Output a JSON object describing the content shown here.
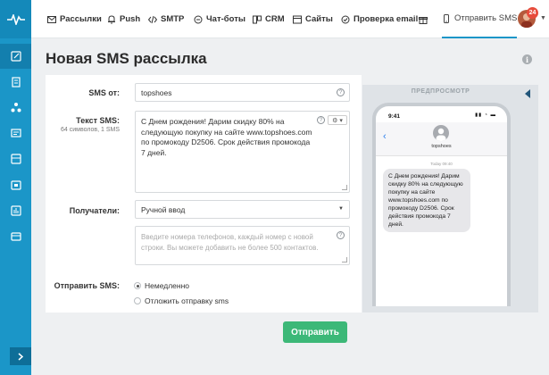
{
  "nav": {
    "items": [
      {
        "label": "Рассылки",
        "icon": "mail-icon"
      },
      {
        "label": "Push",
        "icon": "bell-icon"
      },
      {
        "label": "SMTP",
        "icon": "code-icon"
      },
      {
        "label": "Чат-боты",
        "icon": "chat-icon"
      },
      {
        "label": "CRM",
        "icon": "crm-icon"
      },
      {
        "label": "Сайты",
        "icon": "site-icon"
      },
      {
        "label": "Проверка email",
        "icon": "check-circle-icon"
      },
      {
        "label": "",
        "icon": "gift-icon"
      },
      {
        "label": "Отправить SMS",
        "icon": "phone-icon"
      }
    ],
    "badge_count": "24"
  },
  "page": {
    "title": "Новая SMS рассылка"
  },
  "form": {
    "sender_label": "SMS от:",
    "sender_value": "topshoes",
    "text_label": "Текст SMS:",
    "text_meta": "64 символов, 1 SMS",
    "text_value": "С Днем рождения! Дарим скидку 80% на следующую покупку на сайте www.topshoes.com по промокоду D2506. Срок действия промокода 7 дней.",
    "recipients_label": "Получатели:",
    "recipients_value": "Ручной ввод",
    "phones_placeholder": "Введите номера телефонов, каждый номер с новой строки. Вы можете добавить не более 500 контактов.",
    "send_label": "Отправить SMS:",
    "send_options": [
      "Немедленно",
      "Отложить отправку sms"
    ],
    "send_selected": 0,
    "submit_label": "Отправить"
  },
  "preview": {
    "title": "ПРЕДПРОСМОТР",
    "status_time": "9:41",
    "sender": "topshoes",
    "message_time": "Today 09:40",
    "message": "С Днем рождения! Дарим скидку 80% на следующую покупку на сайте www.topshoes.com по промокоду D2506. Срок действия промокода 7 дней."
  },
  "colors": {
    "sidebar": "#1b96c8",
    "accent": "#1b96c8",
    "submit": "#3cb878",
    "badge": "#e74c3c"
  }
}
